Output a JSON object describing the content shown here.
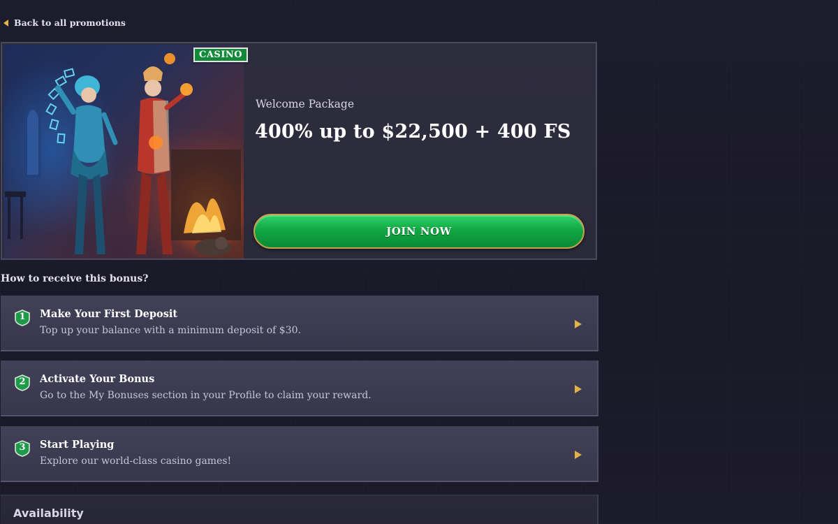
{
  "nav": {
    "back_label": "Back to all promotions"
  },
  "promo": {
    "badge": "CASINO",
    "subtitle": "Welcome Package",
    "headline": "400% up to $22,500 + 400 FS",
    "cta_label": "JOIN NOW"
  },
  "how": {
    "title": "How to receive this bonus?",
    "steps": [
      {
        "number": "1",
        "title": "Make Your First Deposit",
        "description": "Top up your balance with a minimum deposit of $30."
      },
      {
        "number": "2",
        "title": "Activate Your Bonus",
        "description": "Go to the My Bonuses section in your Profile to claim your reward."
      },
      {
        "number": "3",
        "title": "Start Playing",
        "description": "Explore our world-class casino games!"
      }
    ]
  },
  "availability": {
    "label": "Availability"
  },
  "colors": {
    "background": "#1b1a2a",
    "accent_gold": "#e0b34a",
    "cta_green": "#12a844",
    "badge_green": "#128a3a",
    "card": "#2e2d3e",
    "step_card": "#424158"
  },
  "icons": {
    "back": "chevron-left-icon",
    "step_arrow": "chevron-right-icon",
    "step_badge": "shield-number-icon"
  }
}
